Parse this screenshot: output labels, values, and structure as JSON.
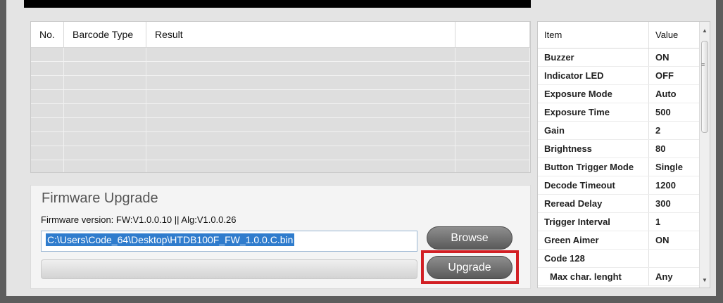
{
  "results_table": {
    "columns": [
      "No.",
      "Barcode Type",
      "Result",
      ""
    ],
    "row_count": 9
  },
  "firmware": {
    "title": "Firmware Upgrade",
    "version_text": "Firmware version: FW:V1.0.0.10 || Alg:V1.0.0.26",
    "file_path": "C:\\Users\\Code_64\\Desktop\\HTDB100F_FW_1.0.0.C.bin",
    "progress_fraction": 0,
    "browse_label": "Browse",
    "upgrade_label": "Upgrade",
    "highlight_color": "#d21f24"
  },
  "settings": {
    "columns": [
      "Item",
      "Value"
    ],
    "rows": [
      {
        "item": "Buzzer",
        "value": "ON"
      },
      {
        "item": "Indicator LED",
        "value": "OFF"
      },
      {
        "item": "Exposure Mode",
        "value": "Auto"
      },
      {
        "item": "Exposure Time",
        "value": "500"
      },
      {
        "item": "Gain",
        "value": "2"
      },
      {
        "item": "Brightness",
        "value": "80"
      },
      {
        "item": "Button Trigger Mode",
        "value": "Single"
      },
      {
        "item": "Decode Timeout",
        "value": "1200"
      },
      {
        "item": "Reread Delay",
        "value": "300"
      },
      {
        "item": "Trigger Interval",
        "value": "1"
      },
      {
        "item": "Green Aimer",
        "value": "ON"
      },
      {
        "item": "Code 128",
        "value": ""
      },
      {
        "item": "Max char. lenght",
        "value": "Any"
      }
    ],
    "icons": {
      "scroll_up": "scroll-up-arrow-icon",
      "scroll_down": "scroll-down-arrow-icon"
    }
  }
}
